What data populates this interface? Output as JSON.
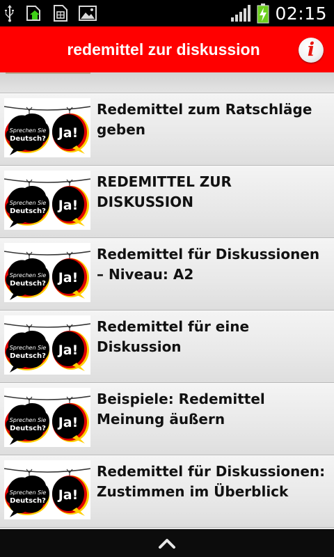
{
  "status_bar": {
    "time": "02:15",
    "icons": [
      "usb-icon",
      "download-complete-icon",
      "sim-card-icon",
      "picture-icon",
      "signal-icon",
      "battery-charging-icon"
    ]
  },
  "action_bar": {
    "title": "redemittel zur diskussion",
    "info_label": "i"
  },
  "thumbnail": {
    "bubble_left_text_1": "Sprechen Sie",
    "bubble_left_text_2": "Deutsch?",
    "bubble_right_text": "Ja!"
  },
  "results": [
    {
      "title": "Redemittel zum Ratschläge geben"
    },
    {
      "title": "REDEMITTEL ZUR DISKUSSION"
    },
    {
      "title": "Redemittel für Diskussionen – Niveau: A2"
    },
    {
      "title": "Redemittel für eine Diskussion"
    },
    {
      "title": "Beispiele: Redemittel Meinung äußern"
    },
    {
      "title": "Redemittel für Diskussionen: Zustimmen im Überblick"
    }
  ],
  "colors": {
    "action_bar": "#ff0000",
    "list_background": "#e9e9e9",
    "flag_black": "#000000",
    "flag_red": "#dd0000",
    "flag_gold": "#ffce00"
  },
  "bottom_bar": {
    "icon": "chevron-up-icon"
  }
}
